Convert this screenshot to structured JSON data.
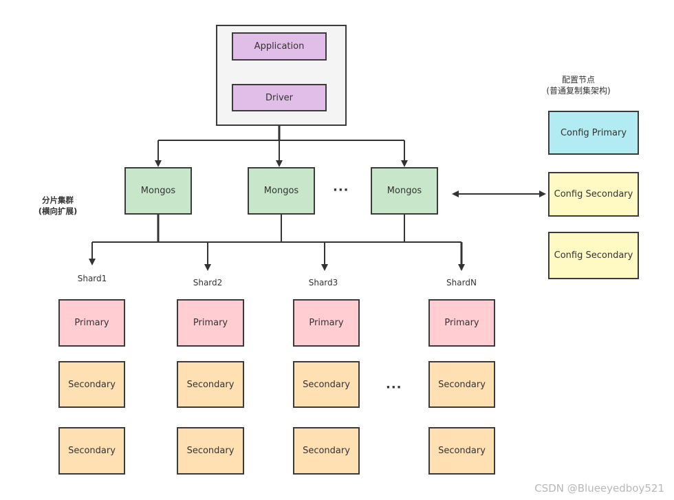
{
  "colors": {
    "client_container": "#f4f4f4",
    "app_driver": "#e1bee7",
    "mongos": "#c8e6c9",
    "config_primary": "#b2ebf2",
    "config_secondary": "#fff9c4",
    "primary": "#ffcdd2",
    "secondary": "#ffe0b2",
    "line": "#333333"
  },
  "client": {
    "application": "Application",
    "driver": "Driver"
  },
  "routers": {
    "items": [
      "Mongos",
      "Mongos",
      "Mongos"
    ],
    "ellipsis": "···"
  },
  "cluster_label": {
    "line1": "分片集群",
    "line2": "(横向扩展)"
  },
  "config": {
    "title_line1": "配置节点",
    "title_line2": "(普通复制集架构)",
    "primary": "Config Primary",
    "secondary_1": "Config Secondary",
    "secondary_2": "Config Secondary"
  },
  "shards": [
    {
      "name": "Shard1",
      "primary": "Primary",
      "secondaries": [
        "Secondary",
        "Secondary"
      ]
    },
    {
      "name": "Shard2",
      "primary": "Primary",
      "secondaries": [
        "Secondary",
        "Secondary"
      ]
    },
    {
      "name": "Shard3",
      "primary": "Primary",
      "secondaries": [
        "Secondary",
        "Secondary"
      ]
    },
    {
      "name": "ShardN",
      "primary": "Primary",
      "secondaries": [
        "Secondary",
        "Secondary"
      ]
    }
  ],
  "shards_ellipsis": "···",
  "watermark": "CSDN @Blueeyedboy521"
}
